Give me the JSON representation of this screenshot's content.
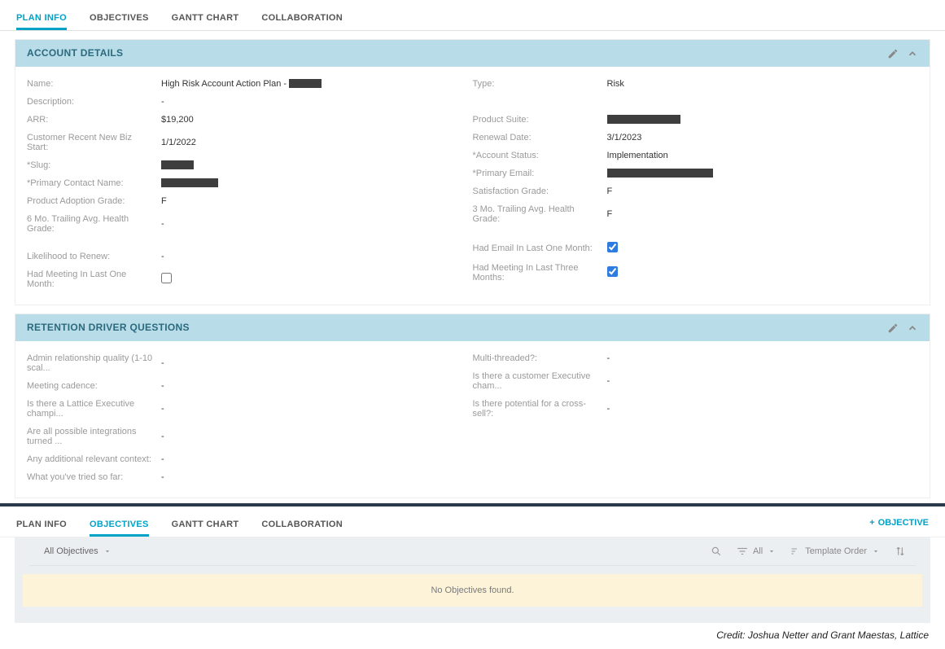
{
  "tabs_top": {
    "plan_info": "PLAN INFO",
    "objectives": "OBJECTIVES",
    "gantt": "GANTT CHART",
    "collab": "COLLABORATION"
  },
  "account_details": {
    "title": "ACCOUNT DETAILS",
    "left": {
      "name_label": "Name:",
      "name_value": "High Risk Account Action Plan - ",
      "desc_label": "Description:",
      "desc_value": "-",
      "arr_label": "ARR:",
      "arr_value": "$19,200",
      "newbiz_label": "Customer Recent New Biz Start:",
      "newbiz_value": "1/1/2022",
      "slug_label": "*Slug:",
      "contact_label": "*Primary Contact Name:",
      "adopt_label": "Product Adoption Grade:",
      "adopt_value": "F",
      "health6_label": "6 Mo. Trailing Avg. Health Grade:",
      "health6_value": "-",
      "renew_like_label": "Likelihood to Renew:",
      "renew_like_value": "-",
      "meeting1_label": "Had Meeting In Last One Month:"
    },
    "right": {
      "type_label": "Type:",
      "type_value": "Risk",
      "suite_label": "Product Suite:",
      "renewal_label": "Renewal Date:",
      "renewal_value": "3/1/2023",
      "status_label": "*Account Status:",
      "status_value": "Implementation",
      "email_label": "*Primary Email:",
      "sat_label": "Satisfaction Grade:",
      "sat_value": "F",
      "health3_label": "3 Mo. Trailing Avg. Health Grade:",
      "health3_value": "F",
      "had_email_label": "Had Email In Last One Month:",
      "meeting3_label": "Had Meeting In Last Three Months:"
    }
  },
  "retention": {
    "title": "RETENTION DRIVER QUESTIONS",
    "left": {
      "admin_label": "Admin relationship quality (1-10 scal...",
      "admin_value": "-",
      "cadence_label": "Meeting cadence:",
      "cadence_value": "-",
      "lattice_label": "Is there a Lattice Executive champi...",
      "lattice_value": "-",
      "integ_label": "Are all possible integrations turned ...",
      "integ_value": "-",
      "context_label": "Any additional relevant context:",
      "context_value": "-",
      "tried_label": "What you've tried so far:",
      "tried_value": "-"
    },
    "right": {
      "multi_label": "Multi-threaded?:",
      "multi_value": "-",
      "exec_label": "Is there a customer Executive cham...",
      "exec_value": "-",
      "cross_label": "Is there potential for a cross-sell?:",
      "cross_value": "-"
    }
  },
  "tabs_bottom": {
    "plan_info": "PLAN INFO",
    "objectives": "OBJECTIVES",
    "gantt": "GANTT CHART",
    "collab": "COLLABORATION",
    "add": "OBJECTIVE"
  },
  "filters": {
    "scope": "All Objectives",
    "all": "All",
    "order": "Template Order"
  },
  "empty": "No Objectives found.",
  "credit": "Credit: Joshua Netter and Grant Maestas, Lattice"
}
